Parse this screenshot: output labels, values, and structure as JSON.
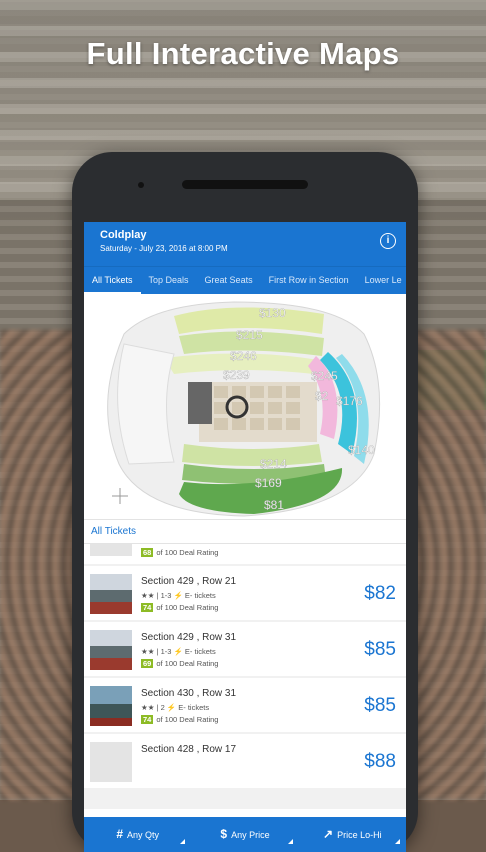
{
  "headline": "Full Interactive Maps",
  "event": {
    "title": "Coldplay",
    "date": "Saturday - July 23, 2016 at 8:00 PM",
    "info_icon": "info-icon"
  },
  "tabs": [
    "All Tickets",
    "Top Deals",
    "Great Seats",
    "First Row in Section",
    "Lower Le"
  ],
  "map": {
    "prices": [
      "$130",
      "$215",
      "$246",
      "$239",
      "$245",
      "$2",
      "$176",
      "$140",
      "$214",
      "$169",
      "$81"
    ],
    "colors": {
      "green_light": "#dfeaa8",
      "green_mid": "#a9d08a",
      "green_dark": "#5fa84e",
      "cyan": "#3cc3dc",
      "pink": "#f2b8dc",
      "floor": "#e3dbcc"
    }
  },
  "list": {
    "header": "All Tickets",
    "partial_top": {
      "score": "68",
      "deal_text": "of 100 Deal Rating"
    },
    "rows": [
      {
        "section": "Section 429 , Row 21",
        "meta": "★★ | 1-3 ⚡ E- tickets",
        "score": "74",
        "deal_text": "of 100 Deal Rating",
        "price": "$82"
      },
      {
        "section": "Section 429 , Row 31",
        "meta": "★★ | 1-3 ⚡ E- tickets",
        "score": "69",
        "deal_text": "of 100 Deal Rating",
        "price": "$85"
      },
      {
        "section": "Section 430 , Row 31",
        "meta": "★★ | 2 ⚡ E- tickets",
        "score": "74",
        "deal_text": "of 100 Deal Rating",
        "price": "$85"
      },
      {
        "section": "Section 428 , Row 17",
        "price": "$88"
      }
    ]
  },
  "bottom": {
    "qty": {
      "icon": "#",
      "label": "Any Qty"
    },
    "price": {
      "icon": "$",
      "label": "Any Price"
    },
    "sort": {
      "icon": "↗",
      "label": "Price Lo-Hi"
    }
  },
  "accent": "#1a75d1"
}
